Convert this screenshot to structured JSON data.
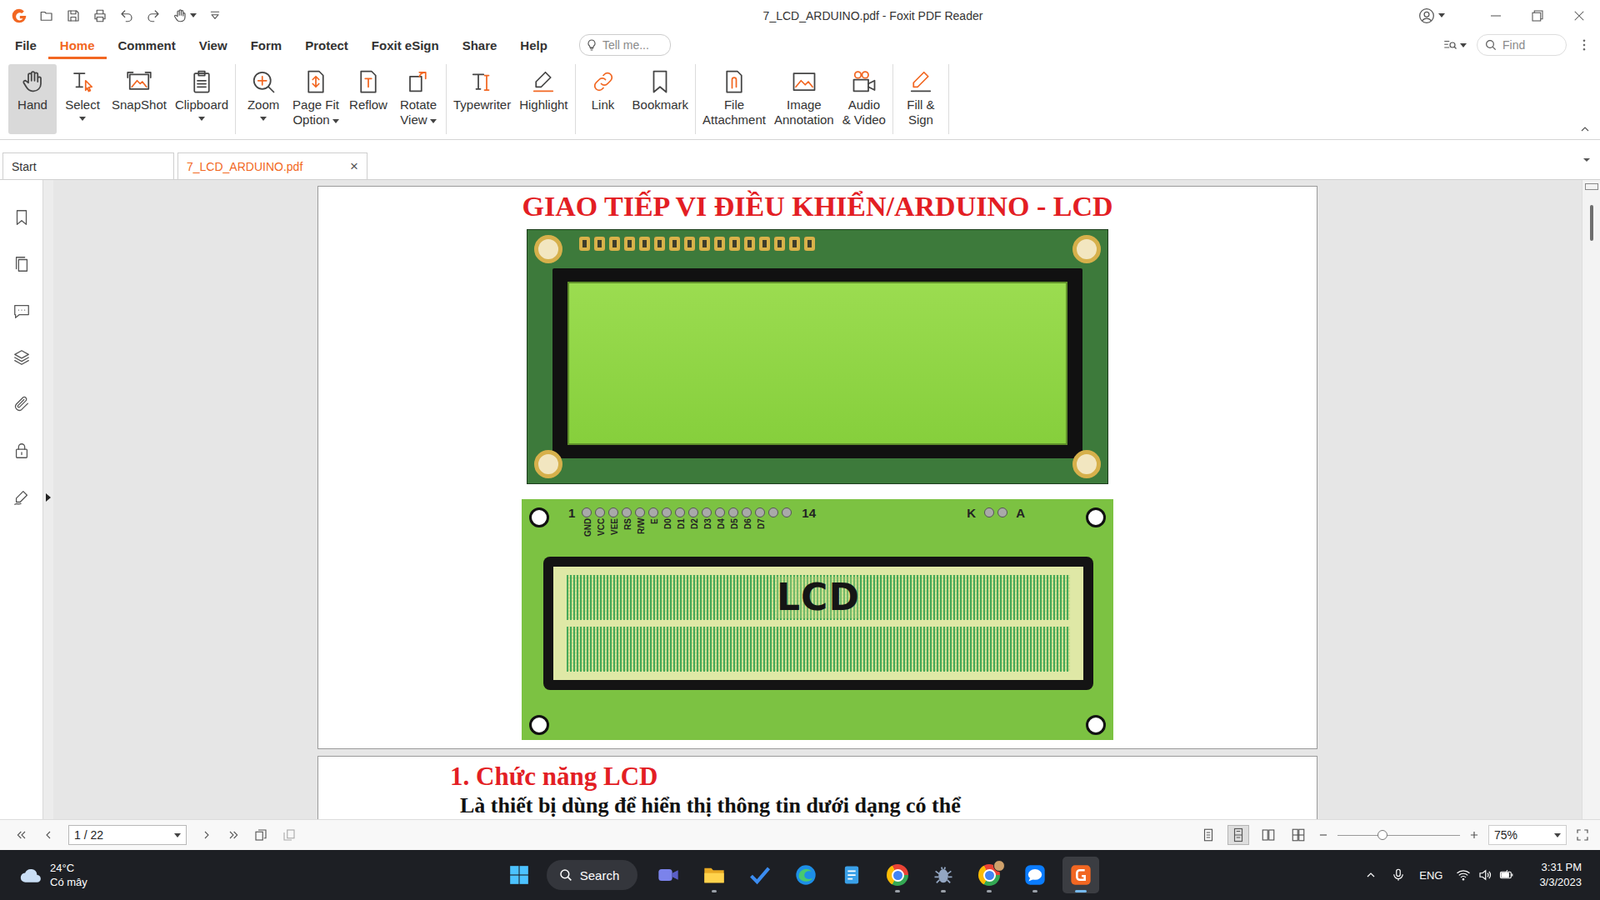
{
  "window": {
    "title": "7_LCD_ARDUINO.pdf - Foxit PDF Reader"
  },
  "menu_tabs": [
    {
      "label": "File",
      "selected": false
    },
    {
      "label": "Home",
      "selected": true
    },
    {
      "label": "Comment",
      "selected": false
    },
    {
      "label": "View",
      "selected": false
    },
    {
      "label": "Form",
      "selected": false
    },
    {
      "label": "Protect",
      "selected": false
    },
    {
      "label": "Foxit eSign",
      "selected": false
    },
    {
      "label": "Share",
      "selected": false
    },
    {
      "label": "Help",
      "selected": false
    }
  ],
  "tell_me": {
    "placeholder": "Tell me..."
  },
  "find": {
    "placeholder": "Find"
  },
  "ribbon_groups": [
    [
      {
        "kind": "hand",
        "lines": [
          "Hand"
        ],
        "selected": true,
        "dropdown": "none"
      },
      {
        "kind": "select",
        "lines": [
          "Select"
        ],
        "selected": false,
        "dropdown": "below"
      },
      {
        "kind": "snapshot",
        "lines": [
          "SnapShot"
        ],
        "selected": false,
        "dropdown": "none"
      },
      {
        "kind": "clipboard",
        "lines": [
          "Clipboard"
        ],
        "selected": false,
        "dropdown": "below"
      }
    ],
    [
      {
        "kind": "zoom",
        "lines": [
          "Zoom"
        ],
        "selected": false,
        "dropdown": "below"
      },
      {
        "kind": "pagefit",
        "lines": [
          "Page Fit",
          "Option"
        ],
        "selected": false,
        "dropdown": "inline"
      },
      {
        "kind": "reflow",
        "lines": [
          "Reflow"
        ],
        "selected": false,
        "dropdown": "none"
      },
      {
        "kind": "rotate",
        "lines": [
          "Rotate",
          "View"
        ],
        "selected": false,
        "dropdown": "inline"
      }
    ],
    [
      {
        "kind": "typewriter",
        "lines": [
          "Typewriter"
        ],
        "selected": false,
        "dropdown": "none"
      },
      {
        "kind": "highlight",
        "lines": [
          "Highlight"
        ],
        "selected": false,
        "dropdown": "none"
      }
    ],
    [
      {
        "kind": "link",
        "lines": [
          "Link"
        ],
        "selected": false,
        "dropdown": "none"
      },
      {
        "kind": "bookmark",
        "lines": [
          "Bookmark"
        ],
        "selected": false,
        "dropdown": "none"
      }
    ],
    [
      {
        "kind": "attachment",
        "lines": [
          "File",
          "Attachment"
        ],
        "selected": false,
        "dropdown": "none"
      },
      {
        "kind": "image",
        "lines": [
          "Image",
          "Annotation"
        ],
        "selected": false,
        "dropdown": "none"
      },
      {
        "kind": "audio",
        "lines": [
          "Audio",
          "& Video"
        ],
        "selected": false,
        "dropdown": "none"
      }
    ],
    [
      {
        "kind": "sign",
        "lines": [
          "Fill &",
          "Sign"
        ],
        "selected": false,
        "dropdown": "none"
      }
    ]
  ],
  "doc_tabs": [
    {
      "label": "Start",
      "selected": false,
      "closable": false
    },
    {
      "label": "7_LCD_ARDUINO.pdf",
      "selected": true,
      "closable": true
    }
  ],
  "tab_close": "×",
  "sidebar": {
    "items": [
      {
        "kind": "bookmarks",
        "expander": false
      },
      {
        "kind": "pages",
        "expander": false
      },
      {
        "kind": "comments",
        "expander": false
      },
      {
        "kind": "layers",
        "expander": false
      },
      {
        "kind": "attachments",
        "expander": false
      },
      {
        "kind": "security",
        "expander": false
      },
      {
        "kind": "signatures",
        "expander": true
      }
    ]
  },
  "document": {
    "title": "GIAO TIẾP VI ĐIỀU KHIỂN/ARDUINO - LCD",
    "diagram": {
      "first_pin": "1",
      "last_pin": "14",
      "backlight_k": "K",
      "backlight_a": "A",
      "pins": [
        "GND",
        "VCC",
        "VEE",
        "RS",
        "R/W",
        "E",
        "D0",
        "D1",
        "D2",
        "D3",
        "D4",
        "D5",
        "D6",
        "D7"
      ],
      "screen_label": "LCD"
    },
    "section_heading": "1. Chức năng LCD",
    "paragraph": "Là thiết bị dùng để hiển thị thông tin dưới dạng có thể"
  },
  "status_bar": {
    "page": "1 / 22",
    "zoom": "75%",
    "zoom_level": 0.37,
    "view_modes": [
      {
        "kind": "single",
        "selected": false
      },
      {
        "kind": "continuous",
        "selected": true
      },
      {
        "kind": "facing",
        "selected": false
      },
      {
        "kind": "continuous-facing",
        "selected": false
      }
    ]
  },
  "taskbar": {
    "weather": {
      "temperature": "24°C",
      "condition": "Có mây"
    },
    "search": "Search",
    "apps": [
      {
        "kind": "meet",
        "running": false,
        "active": false
      },
      {
        "kind": "explorer",
        "running": true,
        "active": false
      },
      {
        "kind": "todo",
        "running": false,
        "active": false
      },
      {
        "kind": "edge",
        "running": false,
        "active": false
      },
      {
        "kind": "notepad",
        "running": false,
        "active": false
      },
      {
        "kind": "chrome",
        "running": true,
        "active": false
      },
      {
        "kind": "bug",
        "running": true,
        "active": false
      },
      {
        "kind": "chrome-profile",
        "running": true,
        "active": false
      },
      {
        "kind": "zalo",
        "running": true,
        "active": false
      },
      {
        "kind": "foxit",
        "running": true,
        "active": true
      }
    ],
    "tray": {
      "language": "ENG",
      "time": "3:31 PM",
      "date": "3/3/2023"
    }
  }
}
